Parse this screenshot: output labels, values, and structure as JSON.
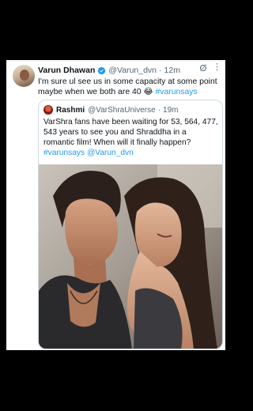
{
  "tweet": {
    "author_name": "Varun Dhawan",
    "author_handle": "@Varun_dvn",
    "separator": "·",
    "time": "12m",
    "text_main": "I'm sure ul see us in some capacity at some point maybe when we both are 40 ",
    "emoji": "😂",
    "hashtag": "#varunsays",
    "icons": {
      "verified": "verified-badge-icon",
      "grok": "grok-icon",
      "more": "more-icon"
    },
    "colors": {
      "accent": "#1d9bf0",
      "muted": "#536471"
    }
  },
  "quote": {
    "author_name": "Rashmi",
    "author_handle": "@VarShraUniverse",
    "separator": "·",
    "time": "19m",
    "text": "VarShra fans have been waiting for 53, 564, 477, 543 years to see you and Shraddha in a romantic film! When will it finally happen?",
    "hashtag": "#varunsays",
    "mention": "@Varun_dvn"
  }
}
